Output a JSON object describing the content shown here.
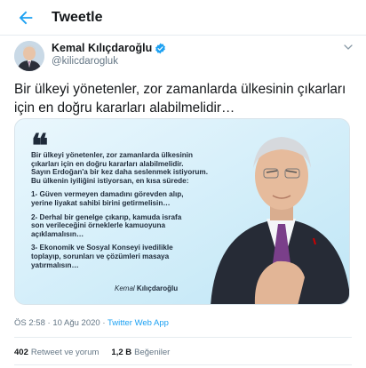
{
  "header": {
    "title": "Tweetle"
  },
  "user": {
    "name": "Kemal Kılıçdaroğlu",
    "handle": "@kilicdarogluk"
  },
  "tweet": {
    "text": "Bir ülkeyi yönetenler, zor zamanlarda ülkesinin çıkarları için en doğru kararları alabilmelidir…",
    "time": "ÖS 2:58",
    "date": "10 Ağu 2020",
    "source": "Twitter Web App"
  },
  "media": {
    "quote_mark": "❝",
    "intro": [
      "Bir ülkeyi yönetenler, zor zamanlarda ülkesinin",
      "çıkarları için en doğru kararları alabilmelidir.",
      "Sayın Erdoğan'a bir kez daha seslenmek istiyorum.",
      "Bu ülkenin iyiliğini istiyorsan, en kısa sürede:"
    ],
    "items": [
      [
        "1- Güven vermeyen damadını görevden alıp,",
        "yerine liyakat sahibi birini getirmelisin…"
      ],
      [
        "2- Derhal bir genelge çıkarıp, kamuda israfa",
        "son verileceğini örneklerle kamuoyuna",
        "açıklamalısın…"
      ],
      [
        "3- Ekonomik ve Sosyal Konseyi ivedilikle",
        "toplayıp, sorunları ve çözümleri masaya",
        "yatırmalısın…"
      ]
    ],
    "signature_first": "Kemal",
    "signature_last": "Kılıçdaroğlu"
  },
  "stats": {
    "retweets_count": "402",
    "retweets_label": "Retweet ve yorum",
    "likes_count": "1,2 B",
    "likes_label": "Beğeniler"
  },
  "colors": {
    "accent": "#1da1f2",
    "secondary_text": "#657786",
    "verified": "#1da1f2"
  }
}
